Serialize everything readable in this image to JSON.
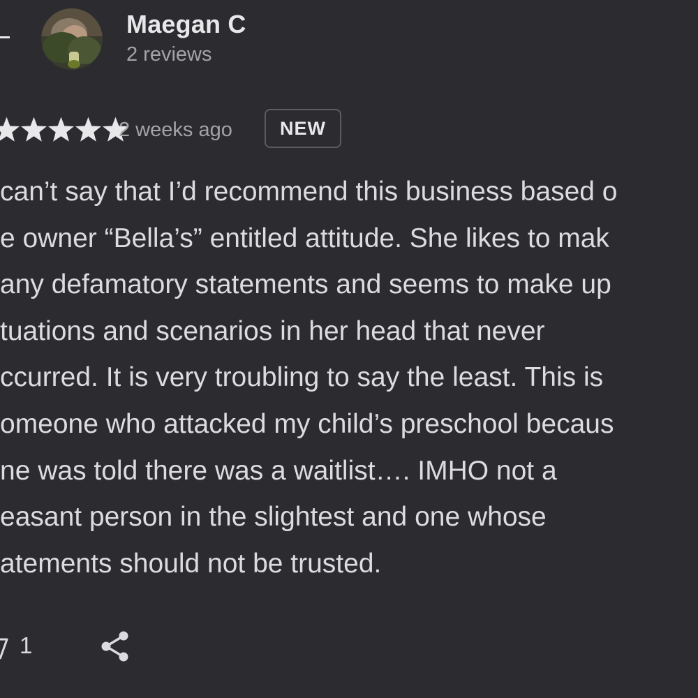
{
  "header": {
    "back_icon": "back-arrow-icon"
  },
  "reviewer": {
    "name": "Maegan C",
    "review_count": "2 reviews",
    "avatar_icon": "user-photo-avatar"
  },
  "review": {
    "rating": 5,
    "rating_max": 5,
    "star_color": "#e8e8ea",
    "date": "2 weeks ago",
    "badge": "NEW",
    "lines": [
      "can’t say that I’d recommend this business based o",
      "e owner “Bella’s” entitled attitude. She likes to mak",
      "any defamatory statements and seems to make up",
      "tuations and scenarios in her head that never",
      "ccurred. It is very troubling to say the least. This is",
      "omeone who attacked my child’s preschool becaus",
      "ne was told there was a waitlist…. IMHO not a",
      "easant person in the slightest and one whose",
      "atements should not be trusted."
    ]
  },
  "actions": {
    "like_icon": "thumbs-up-icon",
    "like_count": "1",
    "share_icon": "share-icon"
  },
  "colors": {
    "background": "#2c2c30",
    "primary_text": "#e8e8ea",
    "secondary_text": "#a4a4a8",
    "badge_border": "#5b5b60"
  }
}
